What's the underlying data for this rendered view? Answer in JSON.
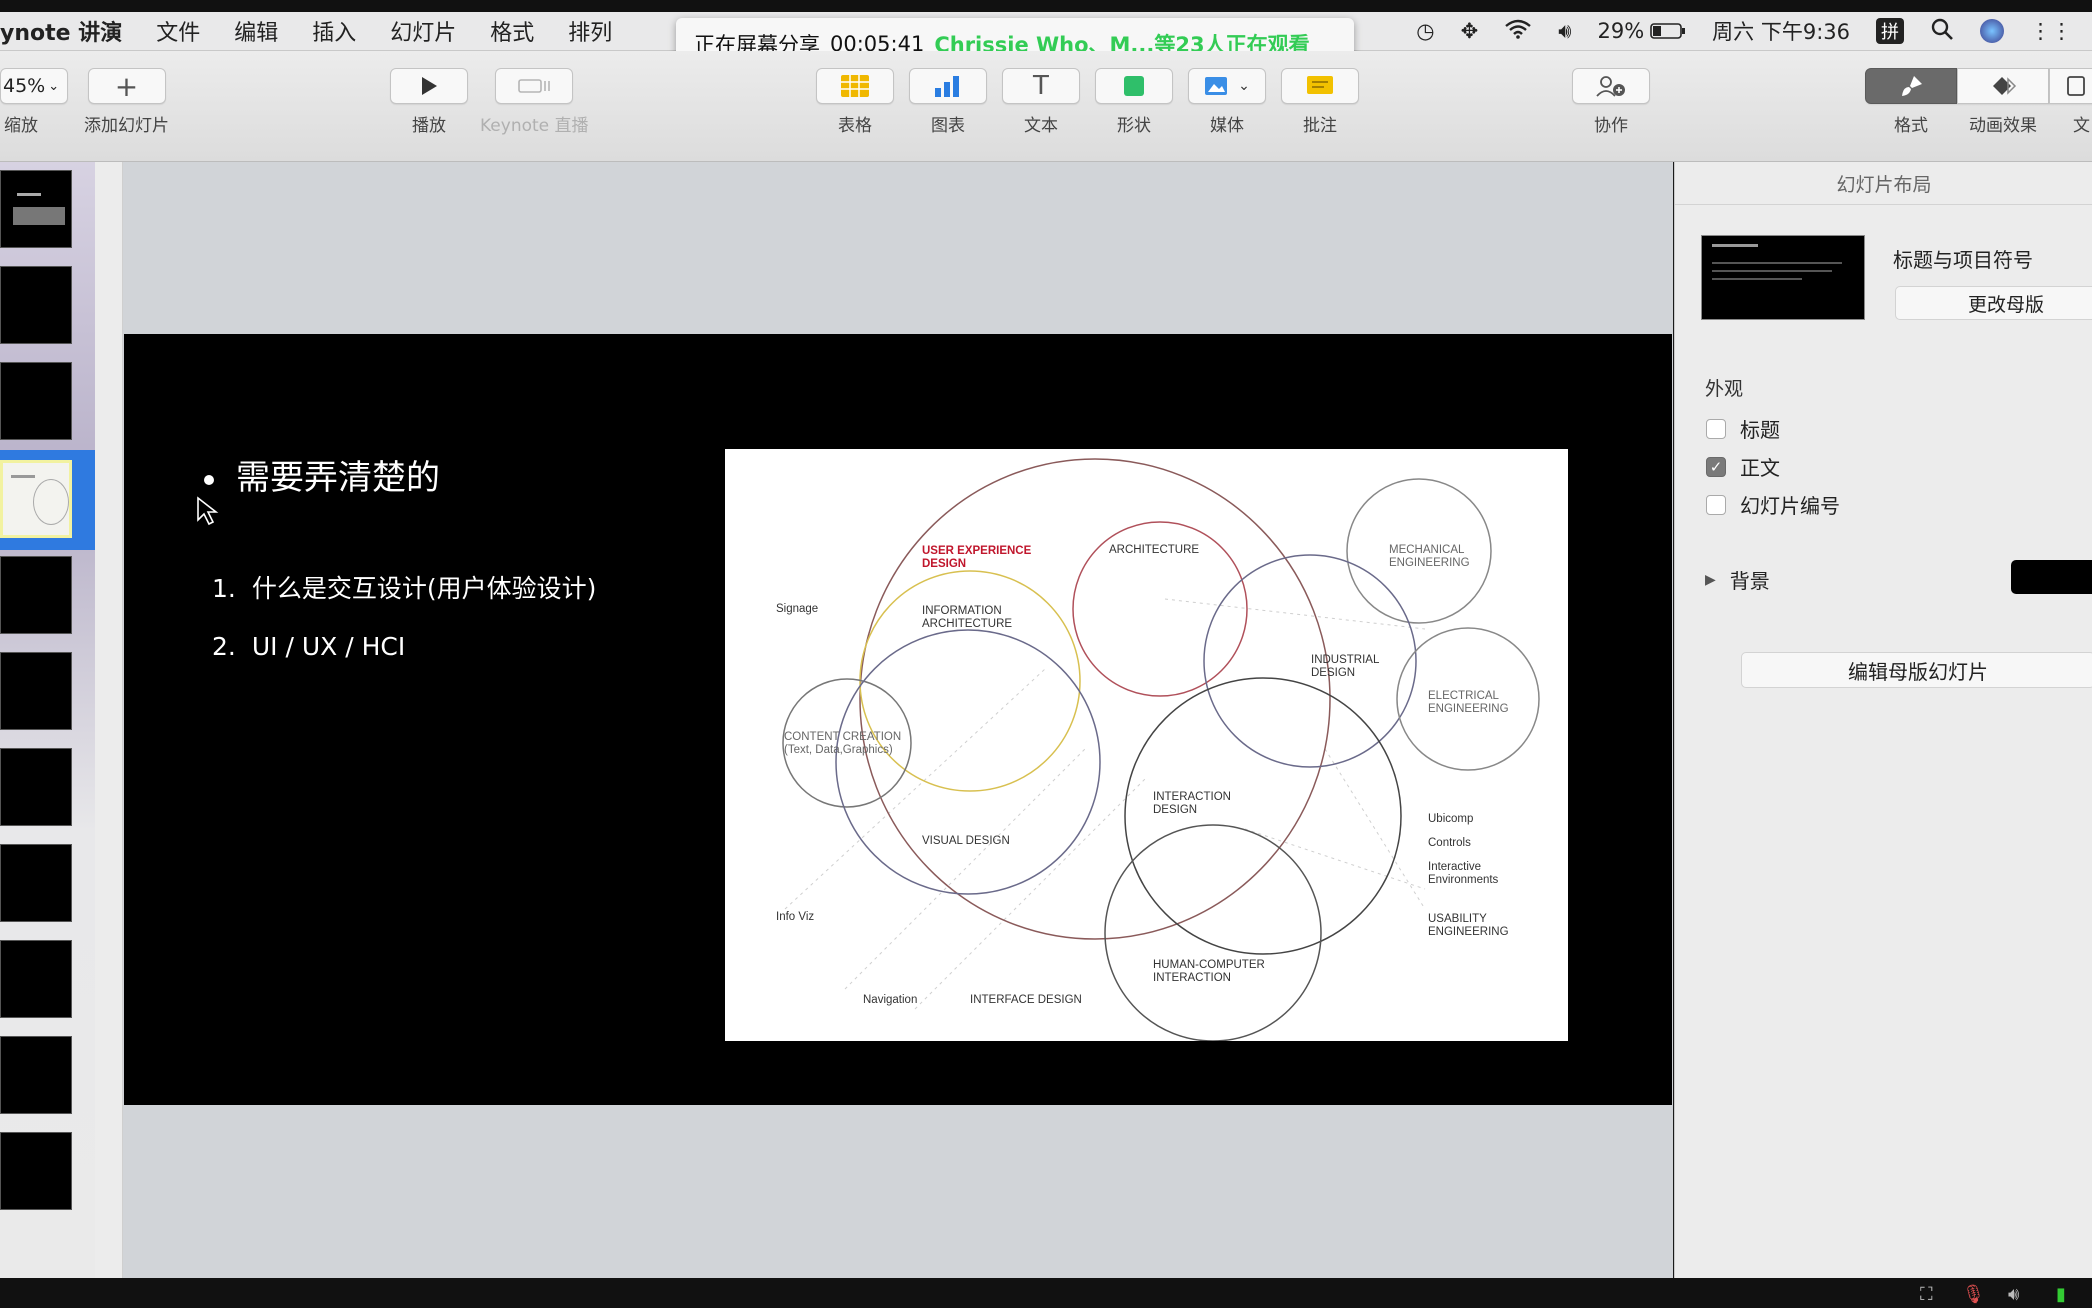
{
  "menubar": {
    "app_name": "ynote 讲演",
    "items": [
      "文件",
      "编辑",
      "插入",
      "幻灯片",
      "格式",
      "排列"
    ],
    "status": {
      "battery": "29%",
      "datetime": "周六 下午9:36",
      "input_method": "拼"
    }
  },
  "share_banner": {
    "label": "正在屏幕分享",
    "timer": "00:05:41",
    "viewers": "Chrissie Who、M...等23人正在观看"
  },
  "toolbar": {
    "zoom_value": "45%",
    "zoom_label": "缩放",
    "add_slide": "添加幻灯片",
    "play": "播放",
    "keynote_live": "Keynote 直播",
    "table": "表格",
    "chart": "图表",
    "text": "文本",
    "shape": "形状",
    "media": "媒体",
    "comment": "批注",
    "collaborate": "协作",
    "format": "格式",
    "animate": "动画效果",
    "document": "文"
  },
  "slide": {
    "bullet": "需要弄清楚的",
    "items": [
      {
        "num": "1.",
        "text": "什么是交互设计(用户体验设计)"
      },
      {
        "num": "2.",
        "text": "UI / UX / HCI"
      }
    ],
    "diagram_labels": {
      "ux": "USER EXPERIENCE",
      "ux2": "DESIGN",
      "architecture": "ARCHITECTURE",
      "mech1": "MECHANICAL",
      "mech2": "ENGINEERING",
      "signage": "Signage",
      "ia1": "INFORMATION",
      "ia2": "ARCHITECTURE",
      "ind1": "INDUSTRIAL",
      "ind2": "DESIGN",
      "elec1": "ELECTRICAL",
      "elec2": "ENGINEERING",
      "cc1": "CONTENT CREATION",
      "cc2": "(Text, Data,Graphics)",
      "ixd1": "INTERACTION",
      "ixd2": "DESIGN",
      "visual": "VISUAL DESIGN",
      "ubicomp": "Ubicomp",
      "controls": "Controls",
      "ie1": "Interactive",
      "ie2": "Environments",
      "infoviz": "Info Viz",
      "usab1": "USABILITY",
      "usab2": "ENGINEERING",
      "hci1": "HUMAN-COMPUTER",
      "hci2": "INTERACTION",
      "navigation": "Navigation",
      "interface": "INTERFACE DESIGN"
    }
  },
  "inspector": {
    "header": "幻灯片布局",
    "layout_name": "标题与项目符号",
    "change_master": "更改母版",
    "appearance": "外观",
    "options": [
      {
        "label": "标题",
        "checked": false
      },
      {
        "label": "正文",
        "checked": true
      },
      {
        "label": "幻灯片编号",
        "checked": false
      }
    ],
    "background": "背景",
    "edit_master": "编辑母版幻灯片"
  },
  "colors": {
    "selection_blue": "#2f7ae0",
    "share_green": "#33cc55",
    "ux_red": "#c0162c"
  }
}
